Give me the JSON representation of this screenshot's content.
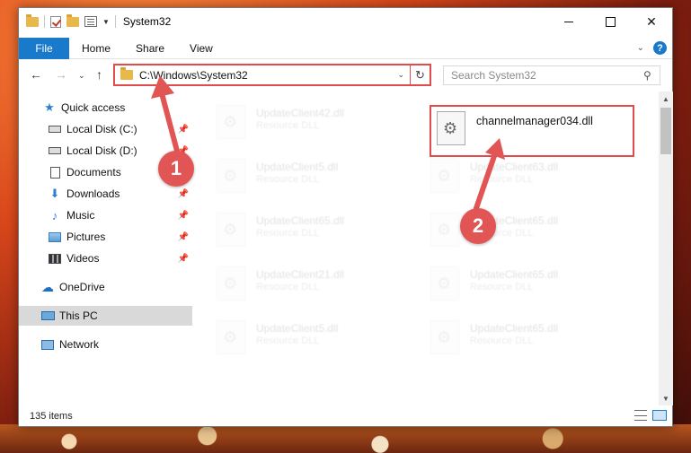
{
  "window": {
    "title": "System32"
  },
  "ribbon": {
    "tabs": [
      "File",
      "Home",
      "Share",
      "View"
    ]
  },
  "address": {
    "path": "C:\\Windows\\System32"
  },
  "search": {
    "placeholder": "Search System32"
  },
  "nav": {
    "items": [
      {
        "label": "Quick access",
        "icon": "star-icon"
      },
      {
        "label": "Local Disk (C:)",
        "icon": "drive-icon",
        "pinned": true
      },
      {
        "label": "Local Disk (D:)",
        "icon": "drive-icon",
        "pinned": true
      },
      {
        "label": "Documents",
        "icon": "documents-icon",
        "pinned": true
      },
      {
        "label": "Downloads",
        "icon": "download-icon",
        "pinned": true
      },
      {
        "label": "Music",
        "icon": "music-icon",
        "pinned": true
      },
      {
        "label": "Pictures",
        "icon": "pictures-icon",
        "pinned": true
      },
      {
        "label": "Videos",
        "icon": "videos-icon",
        "pinned": true
      },
      {
        "label": "OneDrive",
        "icon": "cloud-icon"
      },
      {
        "label": "This PC",
        "icon": "computer-icon",
        "selected": true
      },
      {
        "label": "Network",
        "icon": "network-icon"
      }
    ]
  },
  "files": {
    "highlighted": {
      "name": "channelmanager034.dll"
    },
    "background": [
      {
        "name": "UpdateClient42.dll",
        "type": "Resource DLL"
      },
      {
        "name": "UpdateClient5.dll",
        "type": "Resource DLL"
      },
      {
        "name": "UpdateClient63.dll",
        "type": "Resource DLL"
      },
      {
        "name": "UpdateClient65.dll",
        "type": "Resource DLL"
      },
      {
        "name": "UpdateClient65.dll",
        "type": "Resource DLL"
      },
      {
        "name": "UpdateClient21.dll",
        "type": "Resource DLL"
      },
      {
        "name": "UpdateClient65.dll",
        "type": "Resource DLL"
      },
      {
        "name": "UpdateClient5.dll",
        "type": "Resource DLL"
      },
      {
        "name": "UpdateClient65.dll",
        "type": "Resource DLL"
      }
    ]
  },
  "status": {
    "count": "135 items"
  },
  "annotations": {
    "badge1": "1",
    "badge2": "2",
    "color": "#e25555"
  },
  "colors": {
    "accent": "#1979ca",
    "highlight": "#e24b4b"
  }
}
